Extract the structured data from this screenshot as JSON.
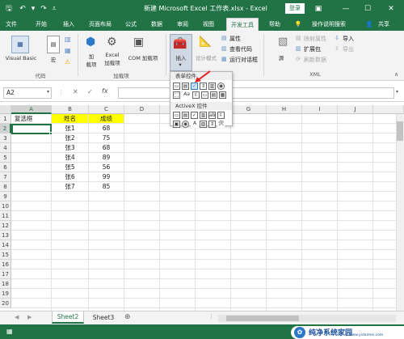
{
  "window": {
    "title": "新建 Microsoft Excel 工作表.xlsx  -  Excel",
    "login_label": "登录"
  },
  "tabs": [
    "文件",
    "开始",
    "插入",
    "页面布局",
    "公式",
    "数据",
    "审阅",
    "视图",
    "开发工具",
    "帮助"
  ],
  "tell_me": "操作说明搜索",
  "share_label": "共享",
  "ribbon": {
    "visual_basic": "Visual Basic",
    "macro": "宏",
    "group_code": "代码",
    "addin": "加\n载项",
    "excel_addin": "Excel\n加载项",
    "com_addin": "COM 加载项",
    "group_addins": "加载项",
    "insert": "插入",
    "design_mode": "设计模式",
    "properties": "属性",
    "view_code": "查看代码",
    "run_dialog": "运行对话框",
    "source": "源",
    "map_properties": "映射属性",
    "expansion_pack": "扩展包",
    "refresh_data": "刷新数据",
    "import": "导入",
    "export": "导出",
    "group_xml": "XML"
  },
  "dropdown": {
    "form_controls": "表单控件",
    "activex_controls": "ActiveX 控件"
  },
  "namebox": "A2",
  "columns": [
    "A",
    "B",
    "C",
    "D",
    "E",
    "F",
    "G",
    "H",
    "I",
    "J"
  ],
  "rows": [
    "1",
    "2",
    "3",
    "4",
    "5",
    "6",
    "7",
    "8",
    "9",
    "10",
    "11",
    "12",
    "13",
    "14",
    "15",
    "16",
    "17",
    "18",
    "19",
    "20"
  ],
  "cells": {
    "a1": "复选框",
    "b1": "姓名",
    "c1": "成绩",
    "names": [
      "张1",
      "张2",
      "张3",
      "张4",
      "张5",
      "张6",
      "张7"
    ],
    "scores": [
      "68",
      "75",
      "68",
      "89",
      "56",
      "99",
      "85"
    ]
  },
  "sheets": [
    "Sheet2",
    "Sheet3"
  ],
  "watermark": {
    "brand": "纯净系统家园",
    "url": "www.yidaimei.com"
  },
  "colors": {
    "excel_green": "#217346",
    "header_yellow": "#ffff00",
    "selection_green": "#217346"
  }
}
